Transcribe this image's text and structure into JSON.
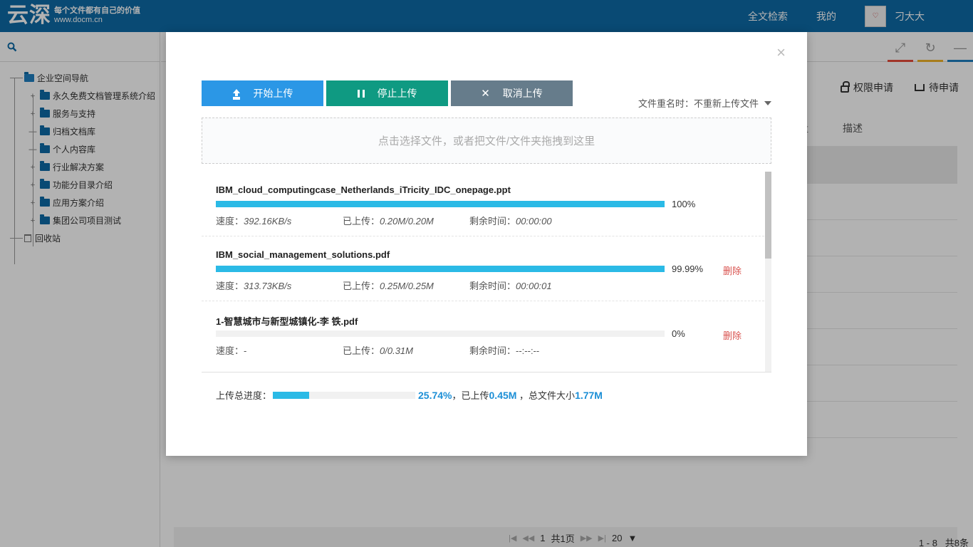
{
  "header": {
    "logo_mark": "云深",
    "slogan": "每个文件都有自己的价值",
    "site": "www.docm.cn",
    "nav": [
      "全文检索",
      "我的"
    ],
    "username": "刁大大"
  },
  "sidebar": {
    "root": "企业空间导航",
    "items": [
      {
        "label": "永久免费文档管理系统介绍"
      },
      {
        "label": "服务与支持"
      },
      {
        "label": "归档文档库"
      },
      {
        "label": "个人内容库"
      },
      {
        "label": "行业解决方案"
      },
      {
        "label": "功能分目录介绍"
      },
      {
        "label": "应用方案介绍"
      },
      {
        "label": "集团公司项目测试"
      }
    ],
    "trash": "回收站"
  },
  "main": {
    "actions": {
      "permission": "权限申请",
      "pending": "待申请"
    },
    "columns": {
      "partial": "量",
      "desc": "描述"
    },
    "pager": {
      "page": "1",
      "total_pages": "共1页",
      "page_size": "20",
      "range": "1 - 8",
      "total": "共8条"
    },
    "ctrl_colors": [
      "#e74c3c",
      "#f0b429",
      "#1f7fc0"
    ]
  },
  "modal": {
    "buttons": {
      "start": "开始上传",
      "pause": "停止上传",
      "cancel": "取消上传"
    },
    "rename": {
      "label": "文件重名时：",
      "value": "不重新上传文件"
    },
    "dropzone": "点击选择文件，或者把文件/文件夹拖拽到这里",
    "files": [
      {
        "name": "IBM_cloud_computingcase_Netherlands_iTricity_IDC_onepage.ppt",
        "progress": 100,
        "pct_label": "100%",
        "speed_label": "速度：",
        "speed": "392.16KB/s",
        "uploaded_label": "已上传：",
        "uploaded": "0.20M/0.20M",
        "remain_label": "剩余时间：",
        "remain": "00:00:00",
        "delete": ""
      },
      {
        "name": "IBM_social_management_solutions.pdf",
        "progress": 99.99,
        "pct_label": "99.99%",
        "speed_label": "速度：",
        "speed": "313.73KB/s",
        "uploaded_label": "已上传：",
        "uploaded": "0.25M/0.25M",
        "remain_label": "剩余时间：",
        "remain": "00:00:01",
        "delete": "删除"
      },
      {
        "name": "1-智慧城市与新型城镇化-李 铁.pdf",
        "progress": 0,
        "pct_label": "0%",
        "speed_label": "速度：",
        "speed": "-",
        "uploaded_label": "已上传：",
        "uploaded": "0/0.31M",
        "remain_label": "剩余时间：",
        "remain": "--:--:--",
        "delete": "删除"
      }
    ],
    "summary": {
      "label": "上传总进度：",
      "progress": 25.74,
      "pct": "25.74%",
      "uploaded_label": "，已上传",
      "uploaded": "0.45M",
      "size_label": " ，总文件大小",
      "size": "1.77M"
    }
  }
}
